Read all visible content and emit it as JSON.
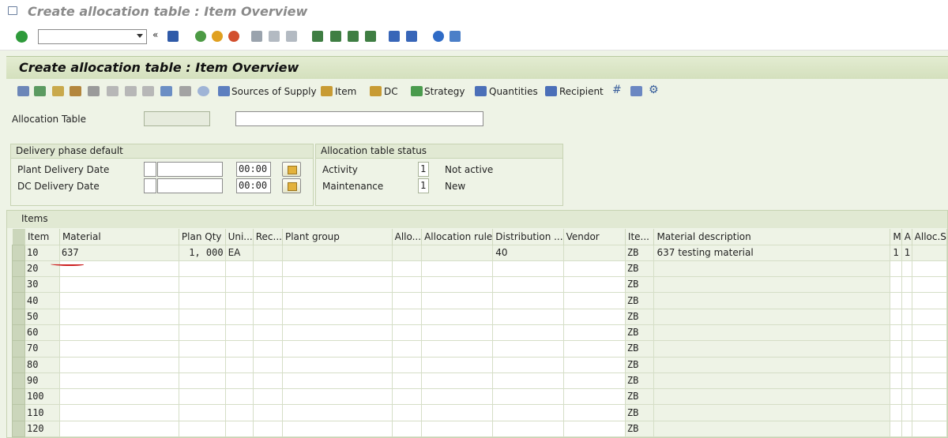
{
  "window": {
    "title": "Create allocation table : Item Overview"
  },
  "toolbar": {
    "command_field": ""
  },
  "screen": {
    "title": "Create allocation table : Item Overview"
  },
  "app_toolbar": {
    "sources_of_supply": "Sources of Supply",
    "item": "Item",
    "dc": "DC",
    "strategy": "Strategy",
    "quantities": "Quantities",
    "recipient": "Recipient"
  },
  "allocation_table": {
    "label": "Allocation Table",
    "number": "",
    "description": ""
  },
  "delivery_phase": {
    "title": "Delivery phase default",
    "plant_label": "Plant Delivery Date",
    "plant_time": "00:00",
    "dc_label": "DC Delivery Date",
    "dc_time": "00:00"
  },
  "status": {
    "title": "Allocation table status",
    "activity_label": "Activity",
    "activity_code": "1",
    "activity_text": "Not active",
    "maintenance_label": "Maintenance",
    "maintenance_code": "1",
    "maintenance_text": "New"
  },
  "items": {
    "title": "Items",
    "columns": [
      "Item",
      "Material",
      "Plan Qty",
      "Uni...",
      "Rec...",
      "Plant group",
      "Allo...",
      "Allocation rule",
      "Distribution ...",
      "Vendor",
      "Ite...",
      "Material description",
      "M",
      "A",
      "Alloc.S"
    ],
    "rows": [
      [
        "10",
        "637",
        "1, 000",
        "EA",
        "",
        "",
        "",
        "",
        "40",
        "",
        "ZB",
        "637 testing material",
        "1",
        "1",
        ""
      ],
      [
        "20",
        "",
        "",
        "",
        "",
        "",
        "",
        "",
        "",
        "",
        "ZB",
        "",
        "",
        "",
        ""
      ],
      [
        "30",
        "",
        "",
        "",
        "",
        "",
        "",
        "",
        "",
        "",
        "ZB",
        "",
        "",
        "",
        ""
      ],
      [
        "40",
        "",
        "",
        "",
        "",
        "",
        "",
        "",
        "",
        "",
        "ZB",
        "",
        "",
        "",
        ""
      ],
      [
        "50",
        "",
        "",
        "",
        "",
        "",
        "",
        "",
        "",
        "",
        "ZB",
        "",
        "",
        "",
        ""
      ],
      [
        "60",
        "",
        "",
        "",
        "",
        "",
        "",
        "",
        "",
        "",
        "ZB",
        "",
        "",
        "",
        ""
      ],
      [
        "70",
        "",
        "",
        "",
        "",
        "",
        "",
        "",
        "",
        "",
        "ZB",
        "",
        "",
        "",
        ""
      ],
      [
        "80",
        "",
        "",
        "",
        "",
        "",
        "",
        "",
        "",
        "",
        "ZB",
        "",
        "",
        "",
        ""
      ],
      [
        "90",
        "",
        "",
        "",
        "",
        "",
        "",
        "",
        "",
        "",
        "ZB",
        "",
        "",
        "",
        ""
      ],
      [
        "100",
        "",
        "",
        "",
        "",
        "",
        "",
        "",
        "",
        "",
        "ZB",
        "",
        "",
        "",
        ""
      ],
      [
        "110",
        "",
        "",
        "",
        "",
        "",
        "",
        "",
        "",
        "",
        "ZB",
        "",
        "",
        "",
        ""
      ],
      [
        "120",
        "",
        "",
        "",
        "",
        "",
        "",
        "",
        "",
        "",
        "ZB",
        "",
        "",
        "",
        ""
      ]
    ]
  },
  "colors": {
    "background": "#eef3e6",
    "header": "#d4e0bd",
    "annotation": "#cc1f1f"
  }
}
